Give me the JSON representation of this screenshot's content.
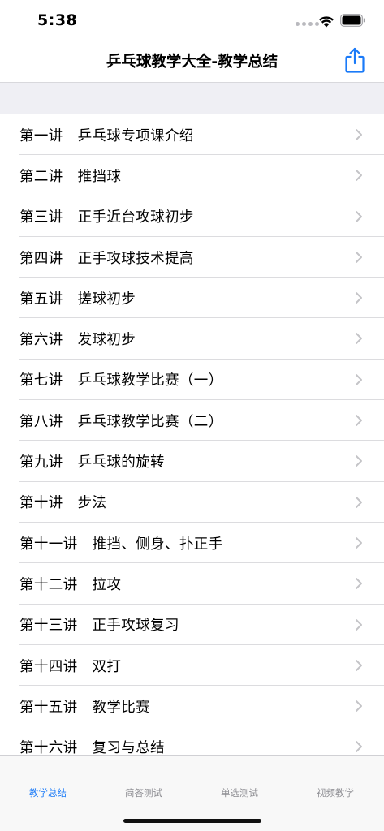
{
  "status_bar": {
    "time": "5:38"
  },
  "nav": {
    "title": "乒乓球教学大全-教学总结"
  },
  "lessons": [
    "第一讲　乒乓球专项课介绍",
    "第二讲　推挡球",
    "第三讲　正手近台攻球初步",
    "第四讲　正手攻球技术提高",
    "第五讲　搓球初步",
    "第六讲　发球初步",
    "第七讲　乒乓球教学比赛（一）",
    "第八讲　乒乓球教学比赛（二）",
    "第九讲　乒乓球的旋转",
    "第十讲　步法",
    "第十一讲　推挡、侧身、扑正手",
    "第十二讲　拉攻",
    "第十三讲　正手攻球复习",
    "第十四讲　双打",
    "第十五讲　教学比赛",
    "第十六讲　复习与总结"
  ],
  "tabs": [
    {
      "label": "教学总结",
      "active": true
    },
    {
      "label": "简答测试",
      "active": false
    },
    {
      "label": "单选测试",
      "active": false
    },
    {
      "label": "视频教学",
      "active": false
    }
  ],
  "colors": {
    "accent": "#1a7af8",
    "inactive_tab": "#8e8e93",
    "group_background": "#efeff4",
    "separator": "#dcdcdf",
    "chevron": "#c4c4c7"
  },
  "icons": {
    "share": "share-icon",
    "chevron": "chevron-right-icon",
    "wifi": "wifi-icon",
    "battery": "battery-icon"
  }
}
